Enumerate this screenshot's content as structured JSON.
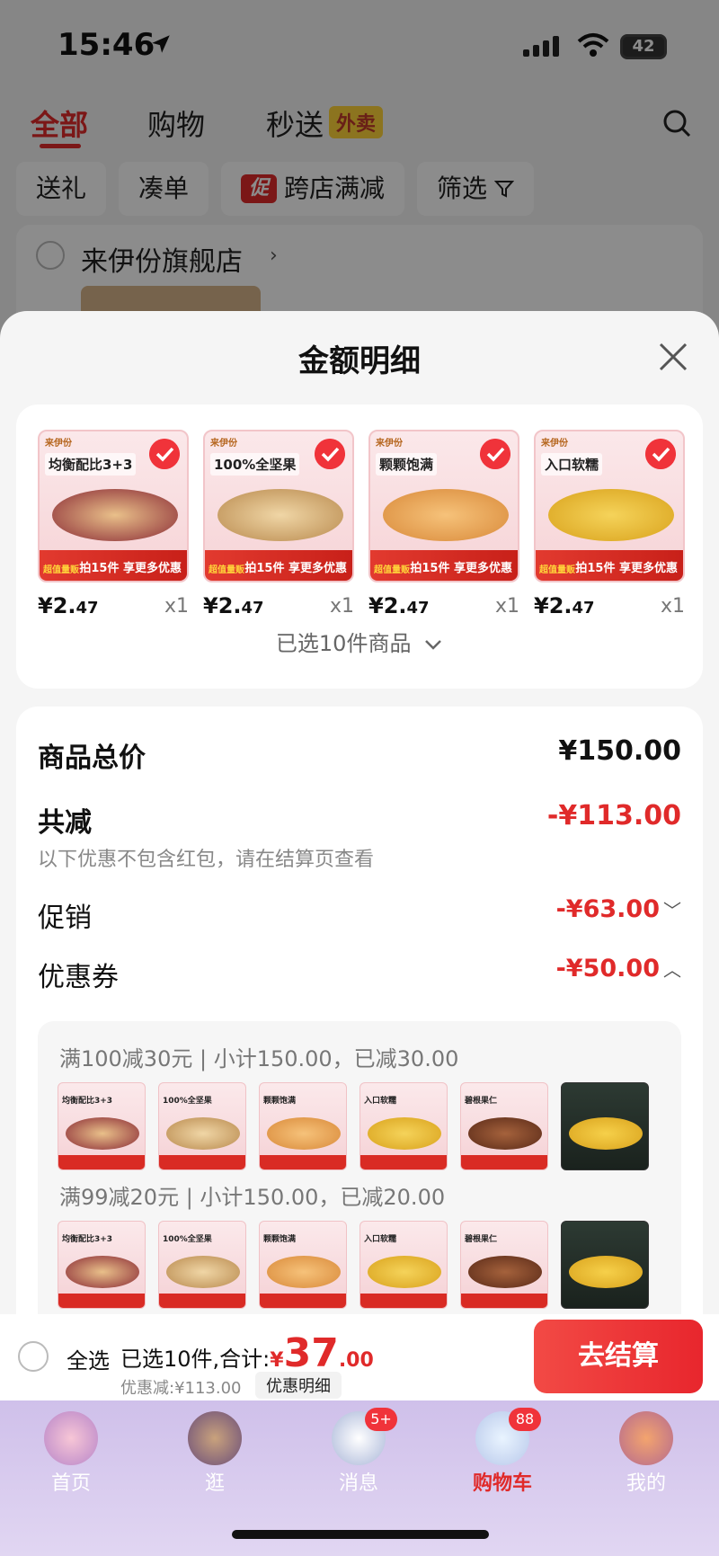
{
  "status_bar": {
    "time": "15:46",
    "battery": "42"
  },
  "top_tabs": [
    {
      "label": "全部",
      "active": true
    },
    {
      "label": "购物",
      "active": false
    },
    {
      "label": "秒送",
      "active": false
    }
  ],
  "takeout_badge": "外卖",
  "chips": {
    "gift": "送礼",
    "bundle": "凑单",
    "promo_tag": "促",
    "cross_store": "跨店满减",
    "filter": "筛选"
  },
  "store": {
    "name": "来伊份旗舰店"
  },
  "sheet": {
    "title": "金额明细",
    "items": [
      {
        "headline": "均衡配比3+3",
        "brand": "来伊份",
        "price_int": "¥2.",
        "price_dec": "47",
        "qty": "x1"
      },
      {
        "headline": "100%全坚果",
        "brand": "来伊份",
        "price_int": "¥2.",
        "price_dec": "47",
        "qty": "x1"
      },
      {
        "headline": "颗颗饱满",
        "brand": "来伊份",
        "price_int": "¥2.",
        "price_dec": "47",
        "qty": "x1"
      },
      {
        "headline": "入口软糯",
        "brand": "来伊份",
        "price_int": "¥2.",
        "price_dec": "47",
        "qty": "x1"
      }
    ],
    "item_banner": "拍15件 享更多优惠",
    "item_banner_tag": "超值量贩",
    "selected_count": "已选10件商品",
    "summary": {
      "goods_total_label": "商品总价",
      "goods_total_value": "¥150.00",
      "total_discount_label": "共减",
      "total_discount_value": "-¥113.00",
      "discount_note": "以下优惠不包含红包，请在结算页查看",
      "promo_label": "促销",
      "promo_value": "-¥63.00",
      "coupon_label": "优惠券",
      "coupon_value": "-¥50.00"
    },
    "coupons": [
      {
        "header": "满100减30元 | 小计150.00，已减30.00"
      },
      {
        "header": "满99减20元 | 小计150.00，已减20.00"
      }
    ],
    "thumb_headlines": [
      "均衡配比3+3",
      "100%全坚果",
      "颗颗饱满",
      "入口软糯",
      "碧根果仁",
      ""
    ]
  },
  "checkout": {
    "select_all": "全选",
    "selected_prefix": "已选10件,合计:",
    "total_yen": "¥",
    "total_big": "37",
    "total_dec": ".00",
    "discount_line": "优惠减:¥113.00",
    "detail_chip": "优惠明细",
    "button": "去结算"
  },
  "tabbar": [
    {
      "label": "首页",
      "badge": ""
    },
    {
      "label": "逛",
      "badge": ""
    },
    {
      "label": "消息",
      "badge": "5+"
    },
    {
      "label": "购物车",
      "badge": "88",
      "active": true
    },
    {
      "label": "我的",
      "badge": ""
    }
  ],
  "colors": {
    "accent": "#e02a2a",
    "tabbar": "#cfc0ea"
  }
}
